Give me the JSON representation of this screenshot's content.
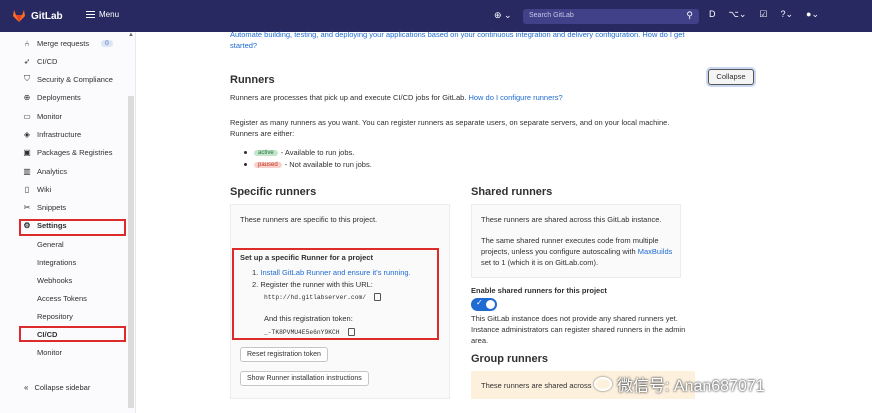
{
  "topbar": {
    "app_name": "GitLab",
    "menu_label": "Menu",
    "plus_label": "⊕ ⌄",
    "search_placeholder": "Search GitLab",
    "brand_color": "#292961"
  },
  "sidebar": {
    "items": [
      {
        "label": "Merge requests",
        "icon": "merge-request-icon",
        "badge": "0"
      },
      {
        "label": "CI/CD",
        "icon": "rocket-icon"
      },
      {
        "label": "Security & Compliance",
        "icon": "shield-icon"
      },
      {
        "label": "Deployments",
        "icon": "deployments-icon"
      },
      {
        "label": "Monitor",
        "icon": "monitor-icon"
      },
      {
        "label": "Infrastructure",
        "icon": "infrastructure-icon"
      },
      {
        "label": "Packages & Registries",
        "icon": "package-icon"
      },
      {
        "label": "Analytics",
        "icon": "analytics-icon"
      },
      {
        "label": "Wiki",
        "icon": "book-icon"
      },
      {
        "label": "Snippets",
        "icon": "scissors-icon"
      },
      {
        "label": "Settings",
        "icon": "gear-icon"
      }
    ],
    "settings_sub": [
      "General",
      "Integrations",
      "Webhooks",
      "Access Tokens",
      "Repository",
      "CI/CD",
      "Monitor"
    ],
    "collapse_label": "Collapse sidebar"
  },
  "main": {
    "intro_text": "Automate building, testing, and deploying your applications based on your continuous integration and delivery configuration.",
    "intro_link": "How do I get started?",
    "runners_title": "Runners",
    "collapse_button": "Collapse",
    "runners_desc": "Runners are processes that pick up and execute CI/CD jobs for GitLab.",
    "runners_desc_link": "How do I configure runners?",
    "register_text": "Register as many runners as you want. You can register runners as separate users, on separate servers, and on your local machine.",
    "runners_either": "Runners are either:",
    "active_pill": "active",
    "active_text": "- Available to run jobs.",
    "paused_pill": "paused",
    "paused_text": "- Not available to run jobs.",
    "specific_title": "Specific runners",
    "specific_desc": "These runners are specific to this project.",
    "setup_title": "Set up a specific Runner for a project",
    "step1_prefix": "1.",
    "step1_link": "Install GitLab Runner and ensure it's running.",
    "step2": "2. Register the runner with this URL:",
    "url": "http://hd.gitlabserver.com/",
    "token_label": "And this registration token:",
    "token": "_-TK8PVMU4E5e6nY9KCH",
    "reset_button": "Reset registration token",
    "show_button": "Show Runner installation instructions",
    "shared_title": "Shared runners",
    "shared_desc": "These runners are shared across this GitLab instance.",
    "shared_desc2": "The same shared runner executes code from multiple projects, unless you configure autoscaling with",
    "shared_link": "MaxBuilds",
    "shared_desc3": "set to 1 (which it is on GitLab.com).",
    "enable_label": "Enable shared runners for this project",
    "shared_none": "This GitLab instance does not provide any shared runners yet. Instance administrators can register shared runners in the admin area.",
    "group_title": "Group runners",
    "group_desc": "These runners are shared across"
  },
  "watermark": "微信号: Anan687071"
}
